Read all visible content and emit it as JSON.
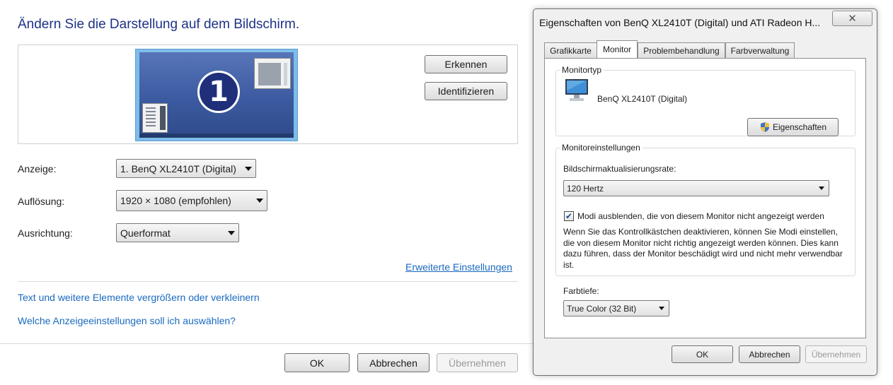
{
  "main": {
    "title": "Ändern Sie die Darstellung auf dem Bildschirm.",
    "monitor_number": "1",
    "detect_label": "Erkennen",
    "identify_label": "Identifizieren",
    "display_label": "Anzeige:",
    "display_value": "1. BenQ XL2410T (Digital)",
    "resolution_label": "Auflösung:",
    "resolution_value": "1920 × 1080 (empfohlen)",
    "orientation_label": "Ausrichtung:",
    "orientation_value": "Querformat",
    "advanced_link": "Erweiterte Einstellungen",
    "link_text_size": "Text und weitere Elemente vergrößern oder verkleinern",
    "link_which_settings": "Welche Anzeigeeinstellungen soll ich auswählen?",
    "ok": "OK",
    "cancel": "Abbrechen",
    "apply": "Übernehmen"
  },
  "dialog": {
    "title": "Eigenschaften von BenQ XL2410T (Digital) und ATI Radeon H...",
    "close_glyph": "✕",
    "tabs": [
      {
        "label": "Grafikkarte"
      },
      {
        "label": "Monitor"
      },
      {
        "label": "Problembehandlung"
      },
      {
        "label": "Farbverwaltung"
      }
    ],
    "active_tab": "Monitor",
    "monitor_type_group": "Monitortyp",
    "monitor_name": "BenQ XL2410T (Digital)",
    "properties_button": "Eigenschaften",
    "monitor_settings_group": "Monitoreinstellungen",
    "refresh_label": "Bildschirmaktualisierungsrate:",
    "refresh_value": "120 Hertz",
    "hide_modes_checked": true,
    "hide_modes_label": "Modi ausblenden, die von diesem Monitor nicht angezeigt werden",
    "warning_text": "Wenn Sie das Kontrollkästchen deaktivieren, können Sie Modi einstellen, die von diesem Monitor nicht richtig angezeigt werden können. Dies kann dazu führen, dass der Monitor beschädigt wird und nicht mehr verwendbar ist.",
    "color_depth_label": "Farbtiefe:",
    "color_depth_value": "True Color (32 Bit)",
    "ok": "OK",
    "cancel": "Abbrechen",
    "apply": "Übernehmen"
  },
  "colors": {
    "title_blue": "#1e3287",
    "link_blue": "#1a6ac0",
    "monitor_badge": "#1f2f7a"
  }
}
